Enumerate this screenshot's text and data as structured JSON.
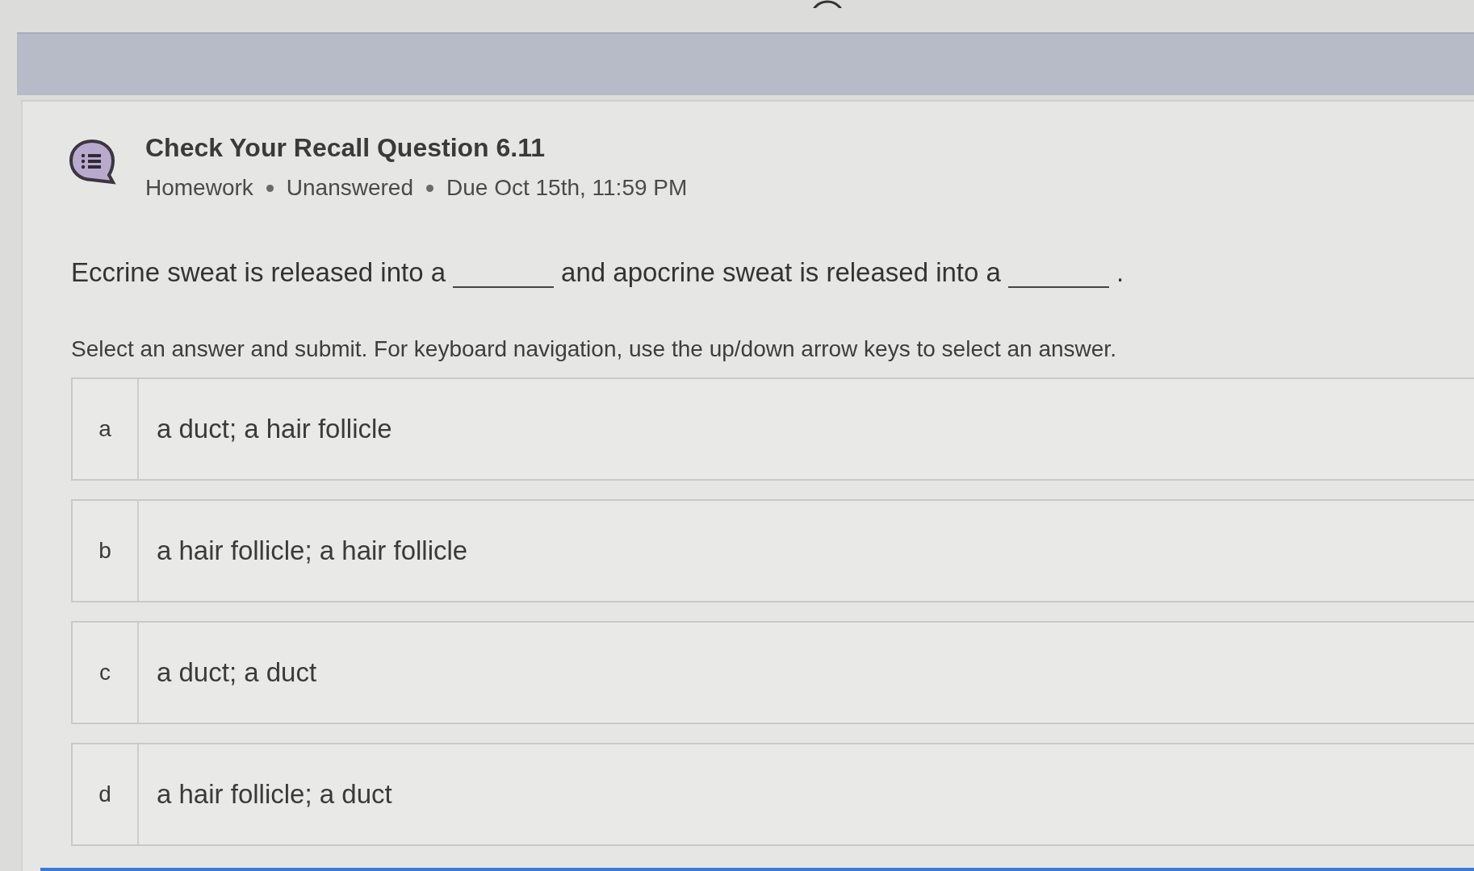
{
  "assignment": {
    "title": "Check Your Recall Question 6.11",
    "meta": [
      "Homework",
      "Unanswered",
      "Due Oct 15th, 11:59 PM"
    ]
  },
  "question": {
    "parts": [
      {
        "kind": "text",
        "text": "Eccrine sweat is released into a"
      },
      {
        "kind": "blank"
      },
      {
        "kind": "text",
        "text": "and apocrine sweat is released into a"
      },
      {
        "kind": "blank"
      },
      {
        "kind": "text",
        "text": "."
      }
    ]
  },
  "instructions": "Select an answer and submit. For keyboard navigation, use the up/down arrow keys to select an answer.",
  "options": [
    {
      "letter": "a",
      "text": "a duct; a hair follicle",
      "selected": false
    },
    {
      "letter": "b",
      "text": "a hair follicle; a hair follicle",
      "selected": false
    },
    {
      "letter": "c",
      "text": "a duct; a duct",
      "selected": false
    },
    {
      "letter": "d",
      "text": "a hair follicle; a duct",
      "selected": false
    }
  ]
}
